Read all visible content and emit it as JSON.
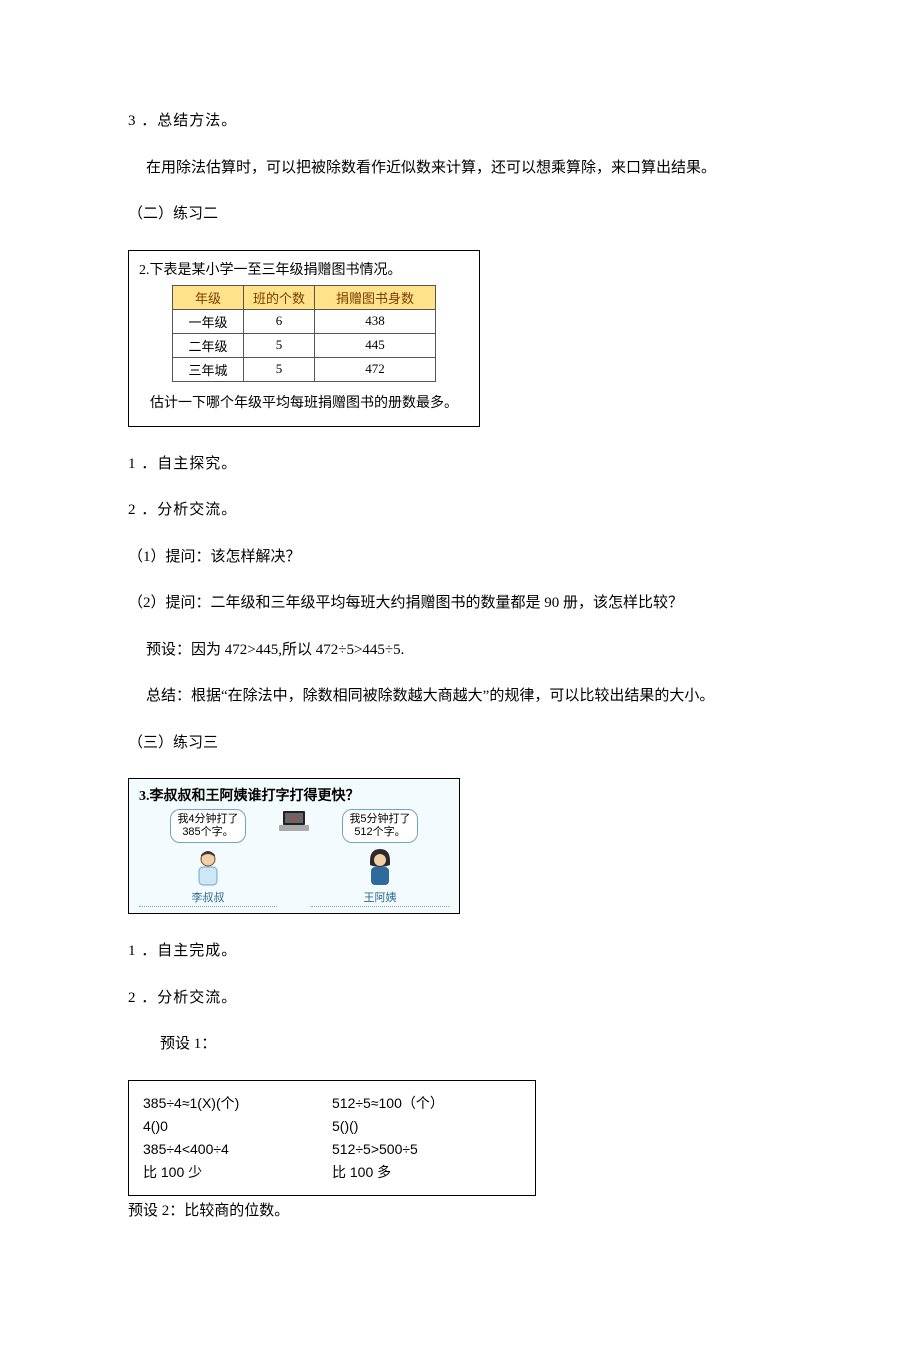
{
  "s1_num": "3 ．总结方法。",
  "s1_body": "在用除法估算时，可以把被除数看作近似数来计算，还可以想乘算除，来口算出结果。",
  "s2_head": "（二）练习二",
  "p2": {
    "title": "2.下表是某小学一至三年级捐赠图书情况。",
    "headers": {
      "c1": "年级",
      "c2": "班的个数",
      "c3": "捐赠图书身数"
    },
    "rows": [
      {
        "c1": "一年级",
        "c2": "6",
        "c3": "438"
      },
      {
        "c1": "二年级",
        "c2": "5",
        "c3": "445"
      },
      {
        "c1": "三年城",
        "c2": "5",
        "c3": "472"
      }
    ],
    "caption": "估计一下哪个年级平均每班捐赠图书的册数最多。"
  },
  "l_zizhu": "1 ．自主探究。",
  "l_fenxi": "2 ．分析交流。",
  "l_q1": "（1）提问：该怎样解决？",
  "l_q2": "（2）提问：二年级和三年级平均每班大约捐赠图书的数量都是 90 册，该怎样比较？",
  "l_preset": "预设：因为 472>445,所以 472÷5>445÷5.",
  "l_summary": "总结：根据“在除法中，除数相同被除数越大商越大”的规律，可以比较出结果的大小。",
  "s3_head": "（三）练习三",
  "p3": {
    "title": "3.李叔叔和王阿姨谁打字打得更快？",
    "left_bubble": "我4分钟打了\n385个字。",
    "right_bubble": "我5分钟打了\n512个字。",
    "left_name": "李叔叔",
    "right_name": "王阿姨"
  },
  "l_ziwan": "1 ．自主完成。",
  "l_fenxi2": "2 ．分析交流。",
  "l_pre1": "预设 1：",
  "calc": {
    "left": {
      "a": "385÷4≈1(X)(个)",
      "b": "4()0",
      "c": "385÷4<400÷4",
      "d": "比 100 少"
    },
    "right": {
      "a": "512÷5≈100（个）",
      "b": "5()()",
      "c": "512÷5>500÷5",
      "d": "比 100 多"
    }
  },
  "l_pre2": "预设 2：比较商的位数。"
}
